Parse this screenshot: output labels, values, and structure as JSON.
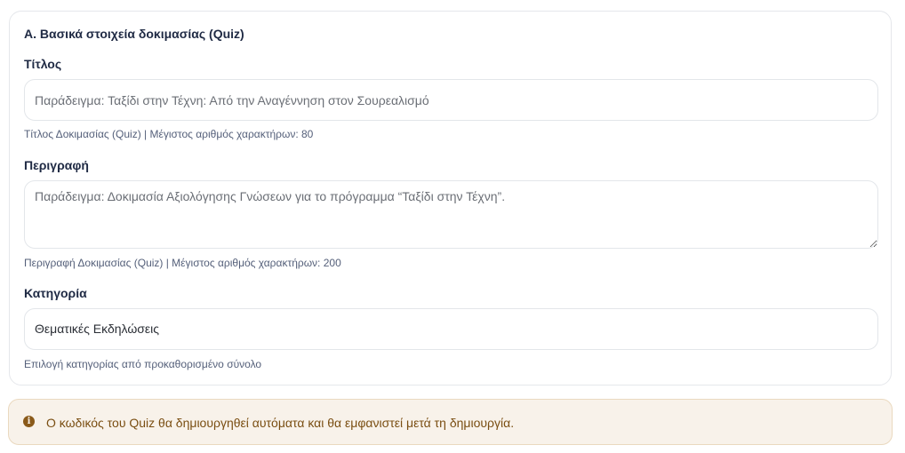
{
  "section": {
    "title": "Α. Βασικά στοιχεία δοκιμασίας (Quiz)"
  },
  "fields": {
    "title": {
      "label": "Τίτλος",
      "placeholder": "Παράδειγμα: Ταξίδι στην Τέχνη: Από την Αναγέννηση στον Σουρεαλισμό",
      "value": "",
      "help": "Τίτλος Δοκιμασίας (Quiz) | Μέγιστος αριθμός χαρακτήρων: 80"
    },
    "description": {
      "label": "Περιγραφή",
      "placeholder": "Παράδειγμα: Δοκιμασία Αξιολόγησης Γνώσεων για το πρόγραμμα “Ταξίδι στην Τέχνη”.",
      "value": "",
      "help": "Περιγραφή Δοκιμασίας (Quiz) | Μέγιστος αριθμός χαρακτήρων: 200"
    },
    "category": {
      "label": "Κατηγορία",
      "selected": "Θεματικές Εκδηλώσεις",
      "help": "Επιλογή κατηγορίας από προκαθορισμένο σύνολο"
    }
  },
  "info": {
    "icon": "info-icon",
    "icon_glyph": "i",
    "text": "Ο κωδικός του Quiz θα δημιουργηθεί αυτόματα και θα εμφανιστεί μετά τη δημιουργία."
  },
  "colors": {
    "heading": "#1f2a44",
    "help_text": "#55607a",
    "info_background": "#f8f2ea",
    "info_text": "#7a4e12"
  }
}
